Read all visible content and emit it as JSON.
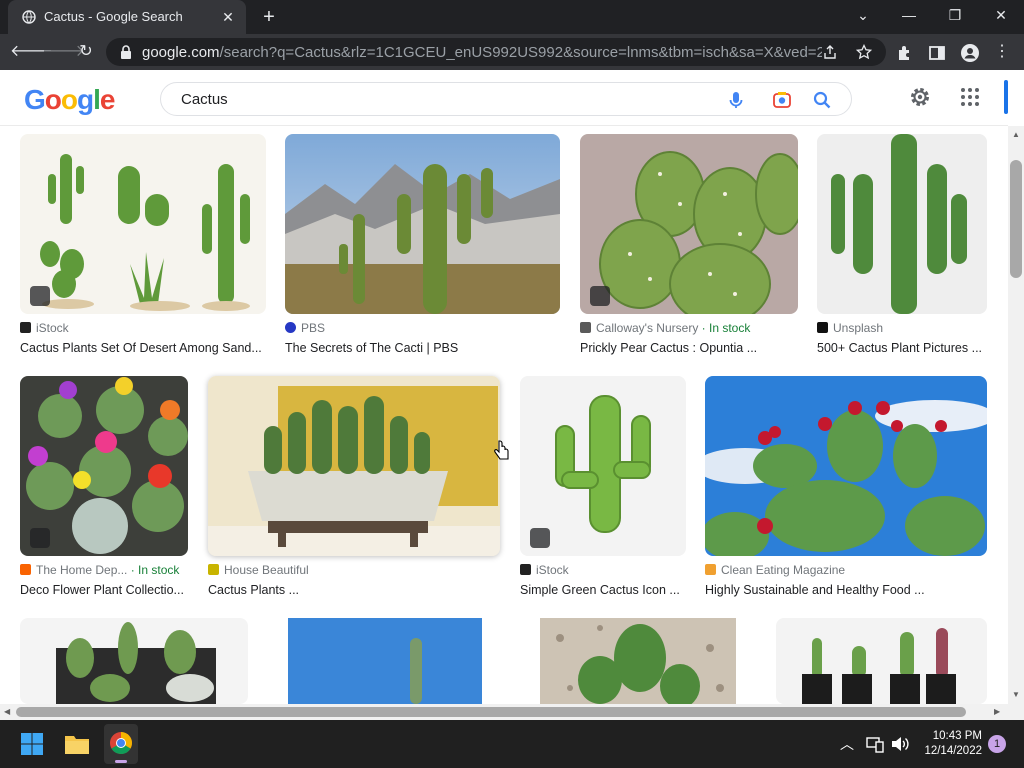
{
  "browser": {
    "tab_title": "Cactus - Google Search",
    "close_tab_glyph": "✕",
    "new_tab_glyph": "+",
    "url_domain": "google.com",
    "url_rest": "/search?q=Cactus&rlz=1C1GCEU_enUS992US992&source=lnms&tbm=isch&sa=X&ved=2ahU...",
    "window_controls": [
      "⌄",
      "—",
      "❐",
      "✕"
    ]
  },
  "google": {
    "logo": "Google",
    "logo_colors": [
      "#4285f4",
      "#ea4335",
      "#fbbc05",
      "#4285f4",
      "#34a853",
      "#ea4335"
    ],
    "query": "Cactus"
  },
  "results": [
    {
      "source": "iStock",
      "title": "Cactus Plants Set Of Desert Among Sand...",
      "stock": "",
      "fav_color": "#222222"
    },
    {
      "source": "PBS",
      "title": "The Secrets of The Cacti | PBS",
      "stock": "",
      "fav_color": "#2638c4"
    },
    {
      "source": "Calloway's Nursery",
      "title": "Prickly Pear Cactus : Opuntia ...",
      "stock": "· In stock",
      "fav_color": "#5a5a5a"
    },
    {
      "source": "Unsplash",
      "title": "500+ Cactus Plant Pictures ...",
      "stock": "",
      "fav_color": "#111111"
    },
    {
      "source": "The Home Dep...",
      "title": "Deco Flower Plant Collectio...",
      "stock": "· In stock",
      "fav_color": "#f96302"
    },
    {
      "source": "House Beautiful",
      "title": "Cactus Plants ...",
      "stock": "",
      "fav_color": "#c8b400"
    },
    {
      "source": "iStock",
      "title": "Simple Green Cactus Icon ...",
      "stock": "",
      "fav_color": "#222222"
    },
    {
      "source": "Clean Eating Magazine",
      "title": "Highly Sustainable and Healthy Food ...",
      "stock": "",
      "fav_color": "#f0a030"
    }
  ],
  "taskbar": {
    "time": "10:43 PM",
    "date": "12/14/2022",
    "notifications": "1"
  }
}
